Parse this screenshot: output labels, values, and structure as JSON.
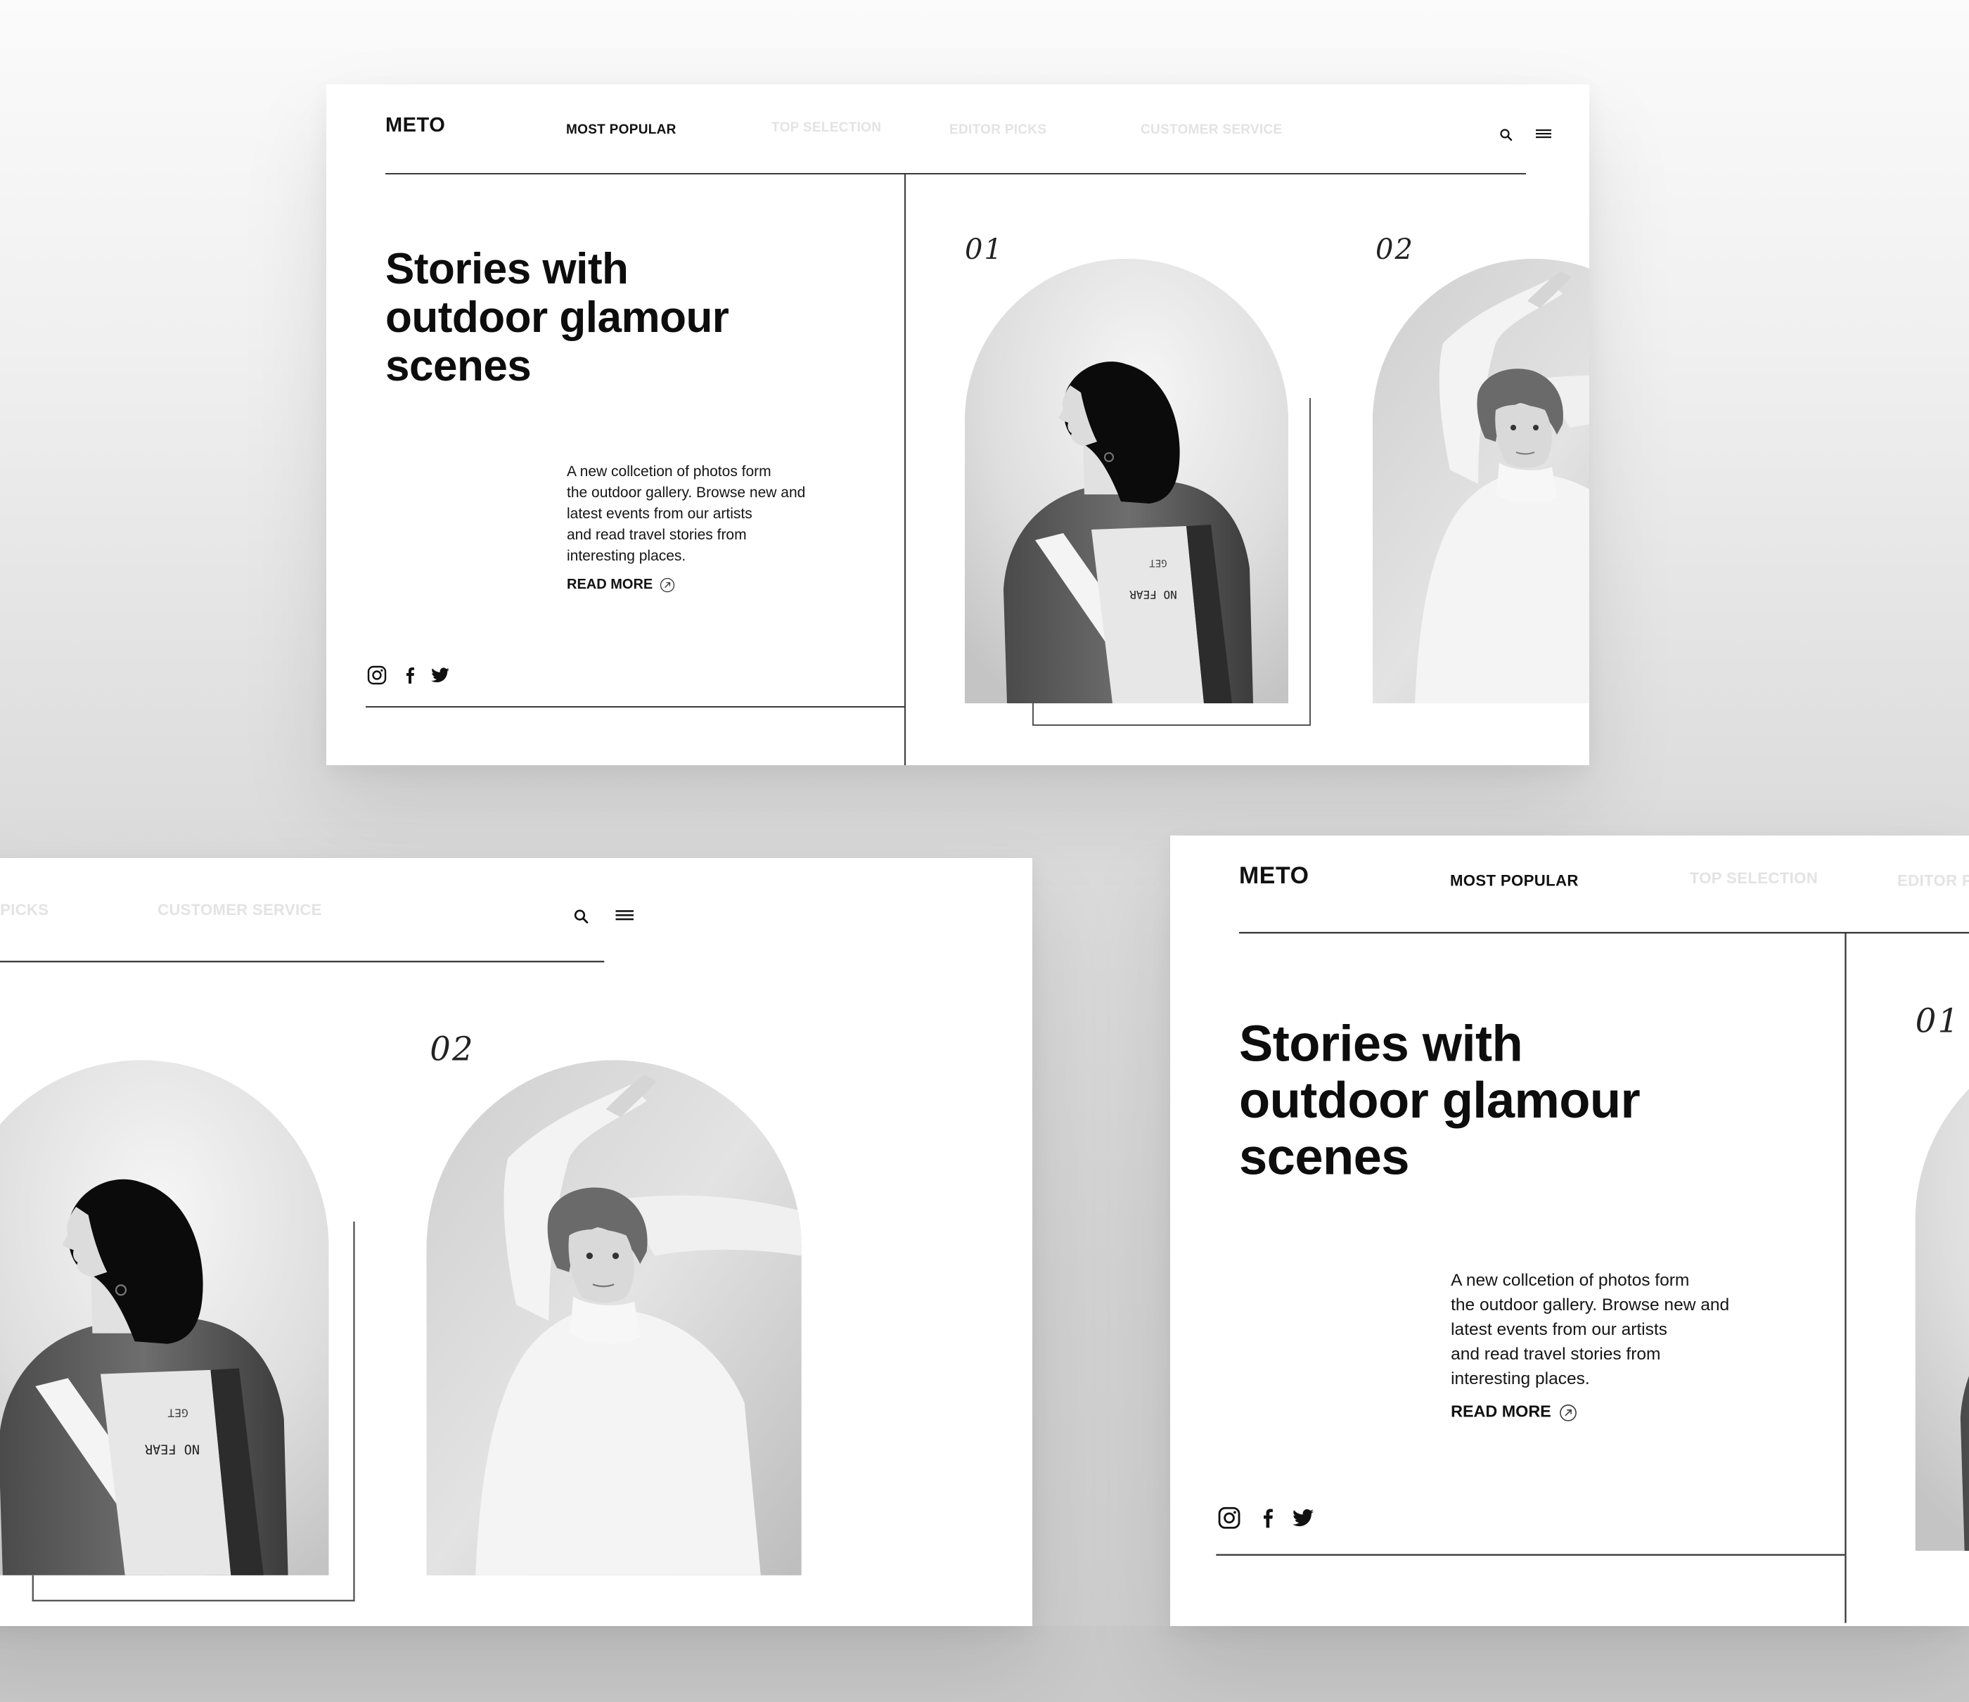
{
  "brand": {
    "logo": "METO"
  },
  "nav": {
    "items": [
      {
        "label": "MOST POPULAR",
        "active": true
      },
      {
        "label": "TOP SELECTION",
        "active": false
      },
      {
        "label": "EDITOR PICKS",
        "active": false
      },
      {
        "label": "CUSTOMER SERVICE",
        "active": false
      }
    ],
    "icons": [
      "search-icon",
      "menu-icon"
    ]
  },
  "hero": {
    "title_lines": [
      "Stories with",
      "outdoor glamour",
      "scenes"
    ],
    "description_lines": [
      "A new collcetion of photos form",
      "the outdoor gallery. Browse new and",
      "latest events from our artists",
      "and read travel stories from",
      "interesting places."
    ],
    "read_more": "READ MORE"
  },
  "social": [
    "instagram-icon",
    "facebook-icon",
    "twitter-icon"
  ],
  "gallery": [
    {
      "number": "01",
      "jacket_text_top": "GET",
      "jacket_text_bottom": "NO FEAR"
    },
    {
      "number": "02"
    }
  ],
  "colors": {
    "background": "#d6d6d6",
    "card": "#ffffff",
    "text": "#111111",
    "nav_dim": "#e3e3e3",
    "line": "#3a3a3a"
  }
}
